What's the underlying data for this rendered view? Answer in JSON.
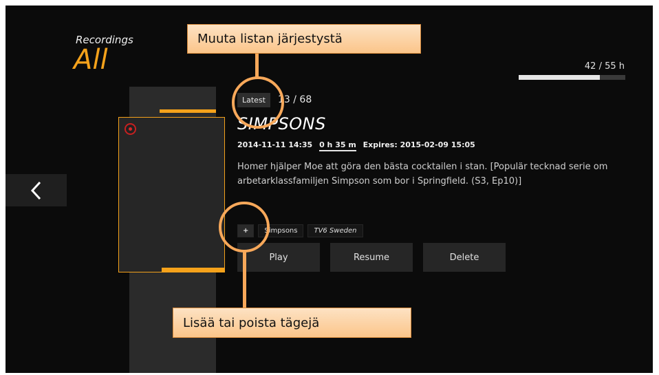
{
  "header": {
    "section_label": "Recordings",
    "filter_title": "All"
  },
  "storage": {
    "text": "42 / 55 h",
    "used_fraction": 0.76
  },
  "navigation": {
    "back_icon": "chevron-left-icon"
  },
  "details": {
    "sort_label": "Latest",
    "counter": "13 / 68",
    "title": "SIMPSONS",
    "datetime": "2014-11-11 14:35",
    "duration": "0 h 35 m",
    "expires": "Expires: 2015-02-09 15:05",
    "description": "Homer hjälper Moe att göra den bästa cocktailen i stan. [Populär tecknad serie om arbetarklassfamiljen Simpson som bor i Springfield. (S3, Ep10)]"
  },
  "tags": {
    "add_label": "+",
    "items": [
      "Simpsons",
      "TV6 Sweden"
    ]
  },
  "actions": {
    "play": "Play",
    "resume": "Resume",
    "delete": "Delete"
  },
  "callouts": {
    "sort": "Muuta listan järjestystä",
    "tags": "Lisää tai poista tägejä"
  },
  "colors": {
    "accent": "#f5a21b",
    "callout": "#f7a85a",
    "background": "#0b0b0b"
  }
}
